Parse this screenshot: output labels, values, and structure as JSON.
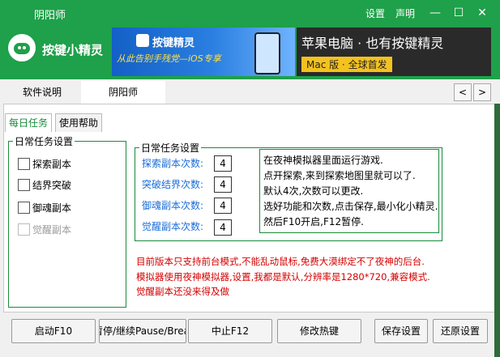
{
  "window": {
    "title": "阴阳师",
    "settings_label": "设置",
    "statement_label": "声明",
    "minimize_glyph": "—",
    "maximize_glyph": "☐",
    "close_glyph": "✕"
  },
  "header": {
    "brand": "按键小精灵",
    "banner_left_title": "按键精灵",
    "banner_left_sub": "从此告别手残党—iOS专享",
    "banner_right_title": "苹果电脑 · 也有按键精灵",
    "banner_right_sub": "Mac 版 · 全球首发"
  },
  "main_tabs": [
    {
      "label": "软件说明"
    },
    {
      "label": "阴阳师"
    }
  ],
  "nav": {
    "prev": "<",
    "next": ">"
  },
  "sub_tabs": [
    {
      "label": "每日任务"
    },
    {
      "label": "使用帮助"
    }
  ],
  "left_group": {
    "title": "日常任务设置",
    "items": [
      {
        "label": "探索副本",
        "enabled": true
      },
      {
        "label": "结界突破",
        "enabled": true
      },
      {
        "label": "御魂副本",
        "enabled": true
      },
      {
        "label": "觉醒副本",
        "enabled": false
      }
    ]
  },
  "right_group": {
    "title": "日常任务设置",
    "fields": [
      {
        "label": "探索副本次数:",
        "value": "4"
      },
      {
        "label": "突破结界次数:",
        "value": "4"
      },
      {
        "label": "御魂副本次数:",
        "value": "4"
      },
      {
        "label": "觉醒副本次数:",
        "value": "4"
      }
    ]
  },
  "info_lines": [
    "在夜神模拟器里面运行游戏.",
    "点开探索,来到探索地图里就可以了.",
    "默认4次,次数可以更改.",
    "选好功能和次数,点击保存,最小化小精灵.",
    "然后F10开启,F12暂停."
  ],
  "notes": [
    "目前版本只支持前台模式,不能乱动鼠标,免费大漠绑定不了夜神的后台.",
    "模拟器使用夜神模拟器,设置,我都是默认,分辨率是1280*720,兼容模式.",
    "觉醒副本还没来得及做"
  ],
  "buttons": {
    "start": "启动F10",
    "pause": "暂停/继续Pause/Break",
    "stop": "中止F12",
    "hotkey": "修改热键",
    "save": "保存设置",
    "restore": "还原设置"
  }
}
